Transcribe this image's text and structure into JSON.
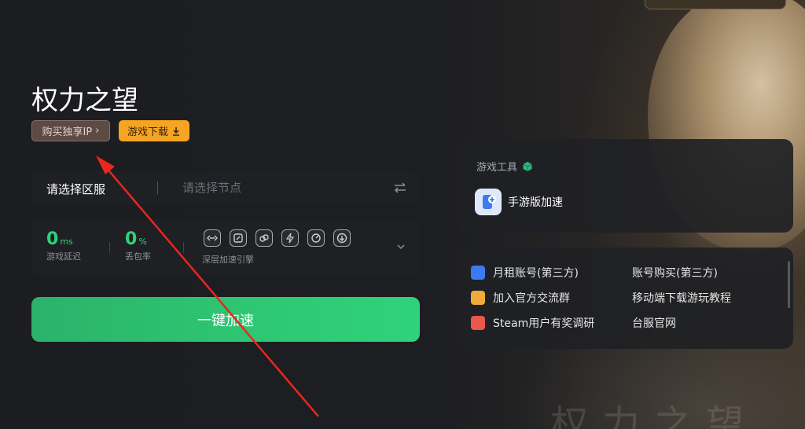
{
  "game": {
    "title": "权力之望",
    "buy_ip_label": "购买独享IP",
    "download_label": "游戏下载"
  },
  "region": {
    "label": "请选择区服",
    "node_placeholder": "请选择节点"
  },
  "stats": {
    "latency_value": "0",
    "latency_unit": "ms",
    "latency_label": "游戏延迟",
    "loss_value": "0",
    "loss_unit": "%",
    "loss_label": "丢包率",
    "engine_label": "深层加速引擎"
  },
  "boost_button": "一键加速",
  "tools": {
    "title": "游戏工具",
    "mobile_label": "手游版加速"
  },
  "links": [
    {
      "label": "月租账号(第三方)",
      "color": "#3a7bf0"
    },
    {
      "label": "账号购买(第三方)"
    },
    {
      "label": "加入官方交流群",
      "color": "#f2a93b"
    },
    {
      "label": "移动端下载游玩教程"
    },
    {
      "label": "Steam用户有奖调研",
      "color": "#e9574c"
    },
    {
      "label": "台服官网"
    }
  ],
  "colors": {
    "accent_green": "#2fd27a",
    "download_orange": "#f6a423",
    "annotation_red": "#e8271e"
  }
}
